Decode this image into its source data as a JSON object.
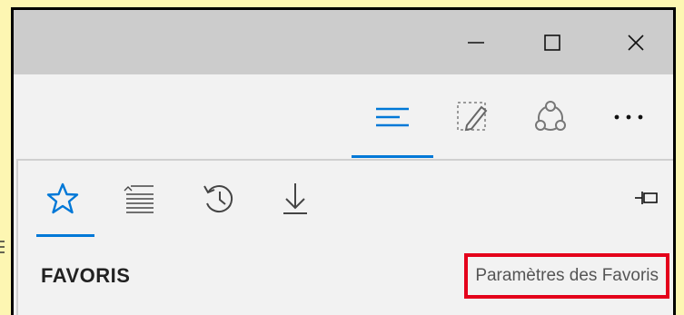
{
  "window": {
    "controls": [
      {
        "name": "minimize",
        "icon": "minimize-icon"
      },
      {
        "name": "maximize",
        "icon": "maximize-icon"
      },
      {
        "name": "close",
        "icon": "close-icon"
      }
    ]
  },
  "toolbar": {
    "buttons": [
      {
        "name": "hub",
        "icon": "hub-lines-icon",
        "active": true
      },
      {
        "name": "web-note",
        "icon": "web-note-pen-icon"
      },
      {
        "name": "share",
        "icon": "share-icon"
      },
      {
        "name": "more",
        "icon": "more-dots-icon",
        "label": "···"
      }
    ]
  },
  "hub": {
    "tabs": [
      {
        "name": "favorites",
        "icon": "star-icon",
        "active": true
      },
      {
        "name": "reading-list",
        "icon": "reading-list-icon"
      },
      {
        "name": "history",
        "icon": "history-icon"
      },
      {
        "name": "downloads",
        "icon": "download-icon"
      }
    ],
    "pin_icon": "pin-icon",
    "heading": "FAVORIS",
    "settings_link": "Paramètres des Favoris"
  },
  "colors": {
    "accent": "#0078d7",
    "highlight_box": "#e4001b",
    "background": "#fdf6b2"
  }
}
